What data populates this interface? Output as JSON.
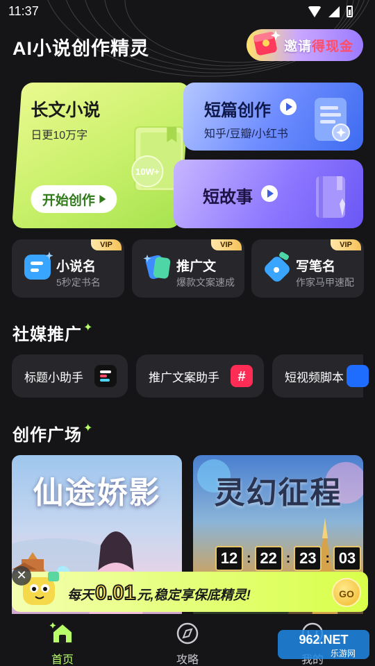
{
  "status_bar": {
    "time": "11:37"
  },
  "header": {
    "app_title": "AI小说创作精灵",
    "invite_prefix": "邀请",
    "invite_highlight": "得现金"
  },
  "features": {
    "long_novel": {
      "title": "长文小说",
      "subtitle": "日更10万字",
      "button": "开始创作",
      "badge": "10W+"
    },
    "short_create": {
      "title": "短篇创作",
      "subtitle": "知乎/豆瓣/小红书"
    },
    "short_story": {
      "title": "短故事"
    }
  },
  "tools": [
    {
      "title": "小说名",
      "subtitle": "5秒定书名",
      "badge": "VIP"
    },
    {
      "title": "推广文",
      "subtitle": "爆款文案速成",
      "badge": "VIP"
    },
    {
      "title": "写笔名",
      "subtitle": "作家马甲速配",
      "badge": "VIP"
    }
  ],
  "social": {
    "title": "社媒推广",
    "chips": [
      {
        "label": "标题小助手"
      },
      {
        "label": "推广文案助手"
      },
      {
        "label": "短视频脚本"
      }
    ]
  },
  "gallery": {
    "title": "创作广场",
    "items": [
      {
        "title": "仙途娇影"
      },
      {
        "title": "灵幻征程",
        "countdown": [
          "12",
          "22",
          "23",
          "03"
        ]
      }
    ]
  },
  "promo": {
    "prefix": "每天",
    "amount": "0.01",
    "suffix": "元,稳定享保底精灵!",
    "go": "GO"
  },
  "nav": {
    "home": "首页",
    "guide": "攻略",
    "mine": "我的"
  },
  "watermark": {
    "brand": "962.NET",
    "sub": "乐游网"
  },
  "colors": {
    "accent": "#b9ff6a",
    "background": "#151518",
    "card": "#26262b"
  }
}
